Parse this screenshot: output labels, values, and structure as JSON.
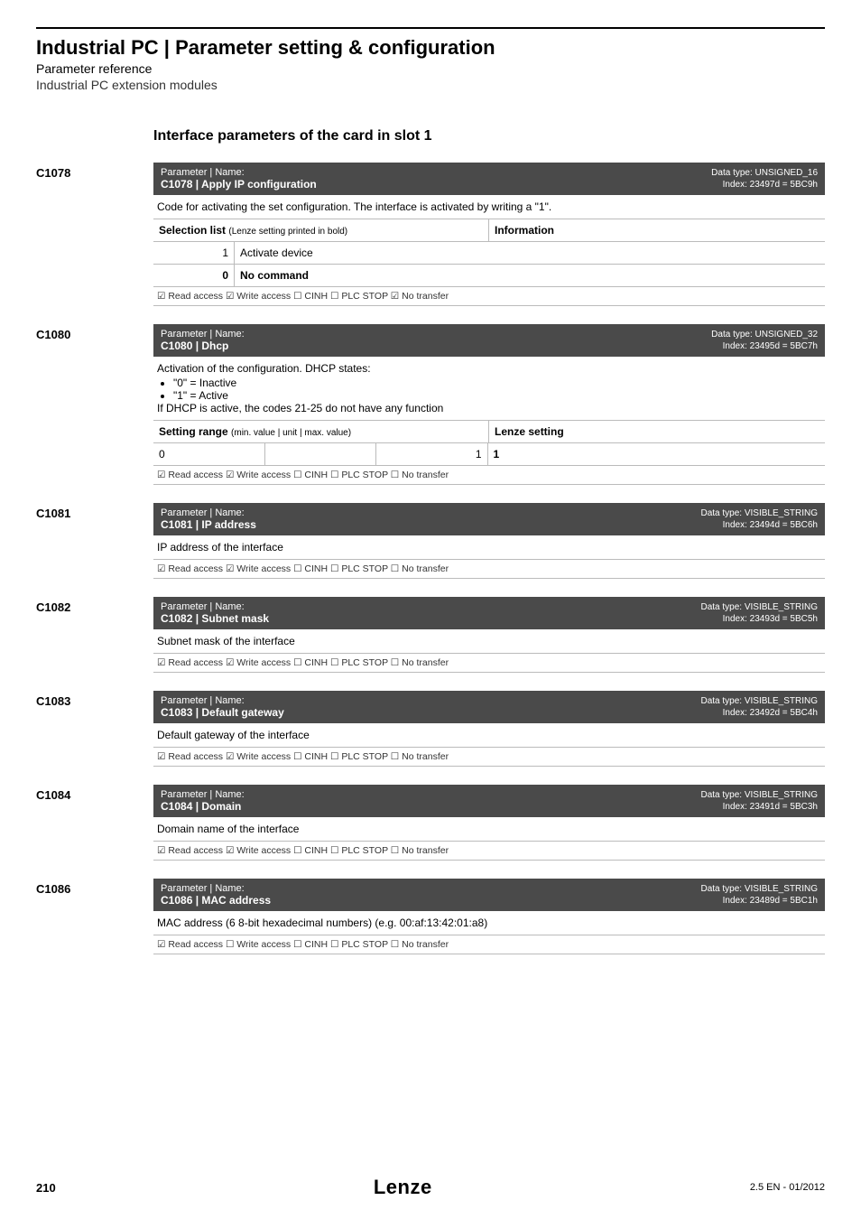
{
  "header": {
    "main_title": "Industrial PC | Parameter setting & configuration",
    "subtitle1": "Parameter reference",
    "subtitle2": "Industrial PC extension modules"
  },
  "section_title": "Interface parameters of the card in slot 1",
  "params": {
    "c1078": {
      "code": "C1078",
      "label": "Parameter | Name:",
      "name": "C1078 | Apply IP configuration",
      "dtype": "Data type: UNSIGNED_16",
      "index": "Index: 23497d = 5BC9h",
      "desc": "Code for activating the set configuration. The interface is activated by writing a \"1\".",
      "sel_label": "Selection list",
      "sel_small": "(Lenze setting printed in bold)",
      "info_label": "Information",
      "rows": [
        {
          "num": "1",
          "label": "Activate device",
          "bold": false
        },
        {
          "num": "0",
          "label": "No command",
          "bold": true
        }
      ],
      "access": "☑ Read access   ☑ Write access   ☐ CINH   ☐ PLC STOP   ☑ No transfer"
    },
    "c1080": {
      "code": "C1080",
      "label": "Parameter | Name:",
      "name": "C1080 | Dhcp",
      "dtype": "Data type: UNSIGNED_32",
      "index": "Index: 23495d = 5BC7h",
      "desc1": "Activation of the configuration. DHCP states:",
      "bullet1": "\"0\" = Inactive",
      "bullet2": "\"1\" = Active",
      "desc2": "If DHCP is active, the codes 21-25 do not have any function",
      "set_label": "Setting range",
      "set_small": "(min. value | unit | max. value)",
      "lenze_label": "Lenze setting",
      "row": {
        "min": "0",
        "unit": "",
        "max": "1",
        "lenze": "1"
      },
      "access": "☑ Read access   ☑ Write access   ☐ CINH   ☐ PLC STOP   ☐ No transfer"
    },
    "c1081": {
      "code": "C1081",
      "label": "Parameter | Name:",
      "name": "C1081 | IP address",
      "dtype": "Data type: VISIBLE_STRING",
      "index": "Index: 23494d = 5BC6h",
      "desc": "IP address of the interface",
      "access": "☑ Read access   ☑ Write access   ☐ CINH   ☐ PLC STOP   ☐ No transfer"
    },
    "c1082": {
      "code": "C1082",
      "label": "Parameter | Name:",
      "name": "C1082 | Subnet mask",
      "dtype": "Data type: VISIBLE_STRING",
      "index": "Index: 23493d = 5BC5h",
      "desc": "Subnet mask of the interface",
      "access": "☑ Read access   ☑ Write access   ☐ CINH   ☐ PLC STOP   ☐ No transfer"
    },
    "c1083": {
      "code": "C1083",
      "label": "Parameter | Name:",
      "name": "C1083 | Default gateway",
      "dtype": "Data type: VISIBLE_STRING",
      "index": "Index: 23492d = 5BC4h",
      "desc": "Default gateway of the interface",
      "access": "☑ Read access   ☑ Write access   ☐ CINH   ☐ PLC STOP   ☐ No transfer"
    },
    "c1084": {
      "code": "C1084",
      "label": "Parameter | Name:",
      "name": "C1084 | Domain",
      "dtype": "Data type: VISIBLE_STRING",
      "index": "Index: 23491d = 5BC3h",
      "desc": "Domain name of the interface",
      "access": "☑ Read access   ☑ Write access   ☐ CINH   ☐ PLC STOP   ☐ No transfer"
    },
    "c1086": {
      "code": "C1086",
      "label": "Parameter | Name:",
      "name": "C1086 | MAC address",
      "dtype": "Data type: VISIBLE_STRING",
      "index": "Index: 23489d = 5BC1h",
      "desc": "MAC address (6 8-bit hexadecimal numbers) (e.g. 00:af:13:42:01:a8)",
      "access": "☑ Read access   ☐ Write access   ☐ CINH   ☐ PLC STOP   ☐ No transfer"
    }
  },
  "footer": {
    "page": "210",
    "logo": "Lenze",
    "rev": "2.5 EN - 01/2012"
  }
}
